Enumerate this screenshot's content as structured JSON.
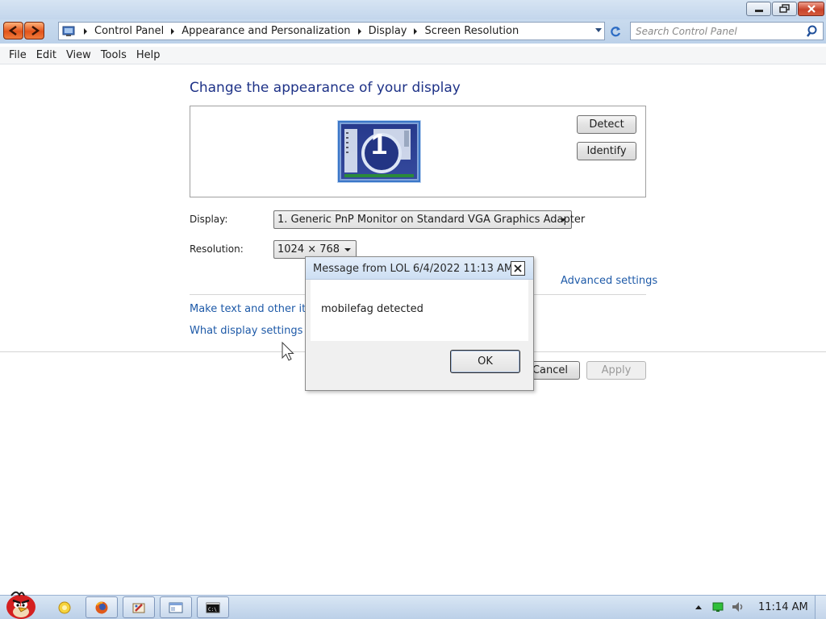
{
  "addressbar": {
    "crumbs": [
      "Control Panel",
      "Appearance and Personalization",
      "Display",
      "Screen Resolution"
    ]
  },
  "search": {
    "placeholder": "Search Control Panel"
  },
  "menu": {
    "items": [
      "File",
      "Edit",
      "View",
      "Tools",
      "Help"
    ]
  },
  "main": {
    "title": "Change the appearance of your display",
    "monitor_number": "1",
    "detect_label": "Detect",
    "identify_label": "Identify",
    "display_label": "Display:",
    "display_value": "1. Generic PnP Monitor on Standard VGA Graphics Adapter",
    "resolution_label": "Resolution:",
    "resolution_value": "1024 × 768",
    "advanced_link": "Advanced settings",
    "text_size_link": "Make text and other iten",
    "what_settings_link": "What display settings sh",
    "cancel_label": "Cancel",
    "apply_label": "Apply"
  },
  "dialog": {
    "title": "Message from LOL 6/4/2022 11:13 AM",
    "message": "mobilefag detected",
    "ok_label": "OK"
  },
  "taskbar": {
    "clock": "11:14 AM"
  },
  "colors": {
    "link": "#1e5aa8",
    "title": "#1e3287",
    "nav_accent": "#e2541c"
  }
}
